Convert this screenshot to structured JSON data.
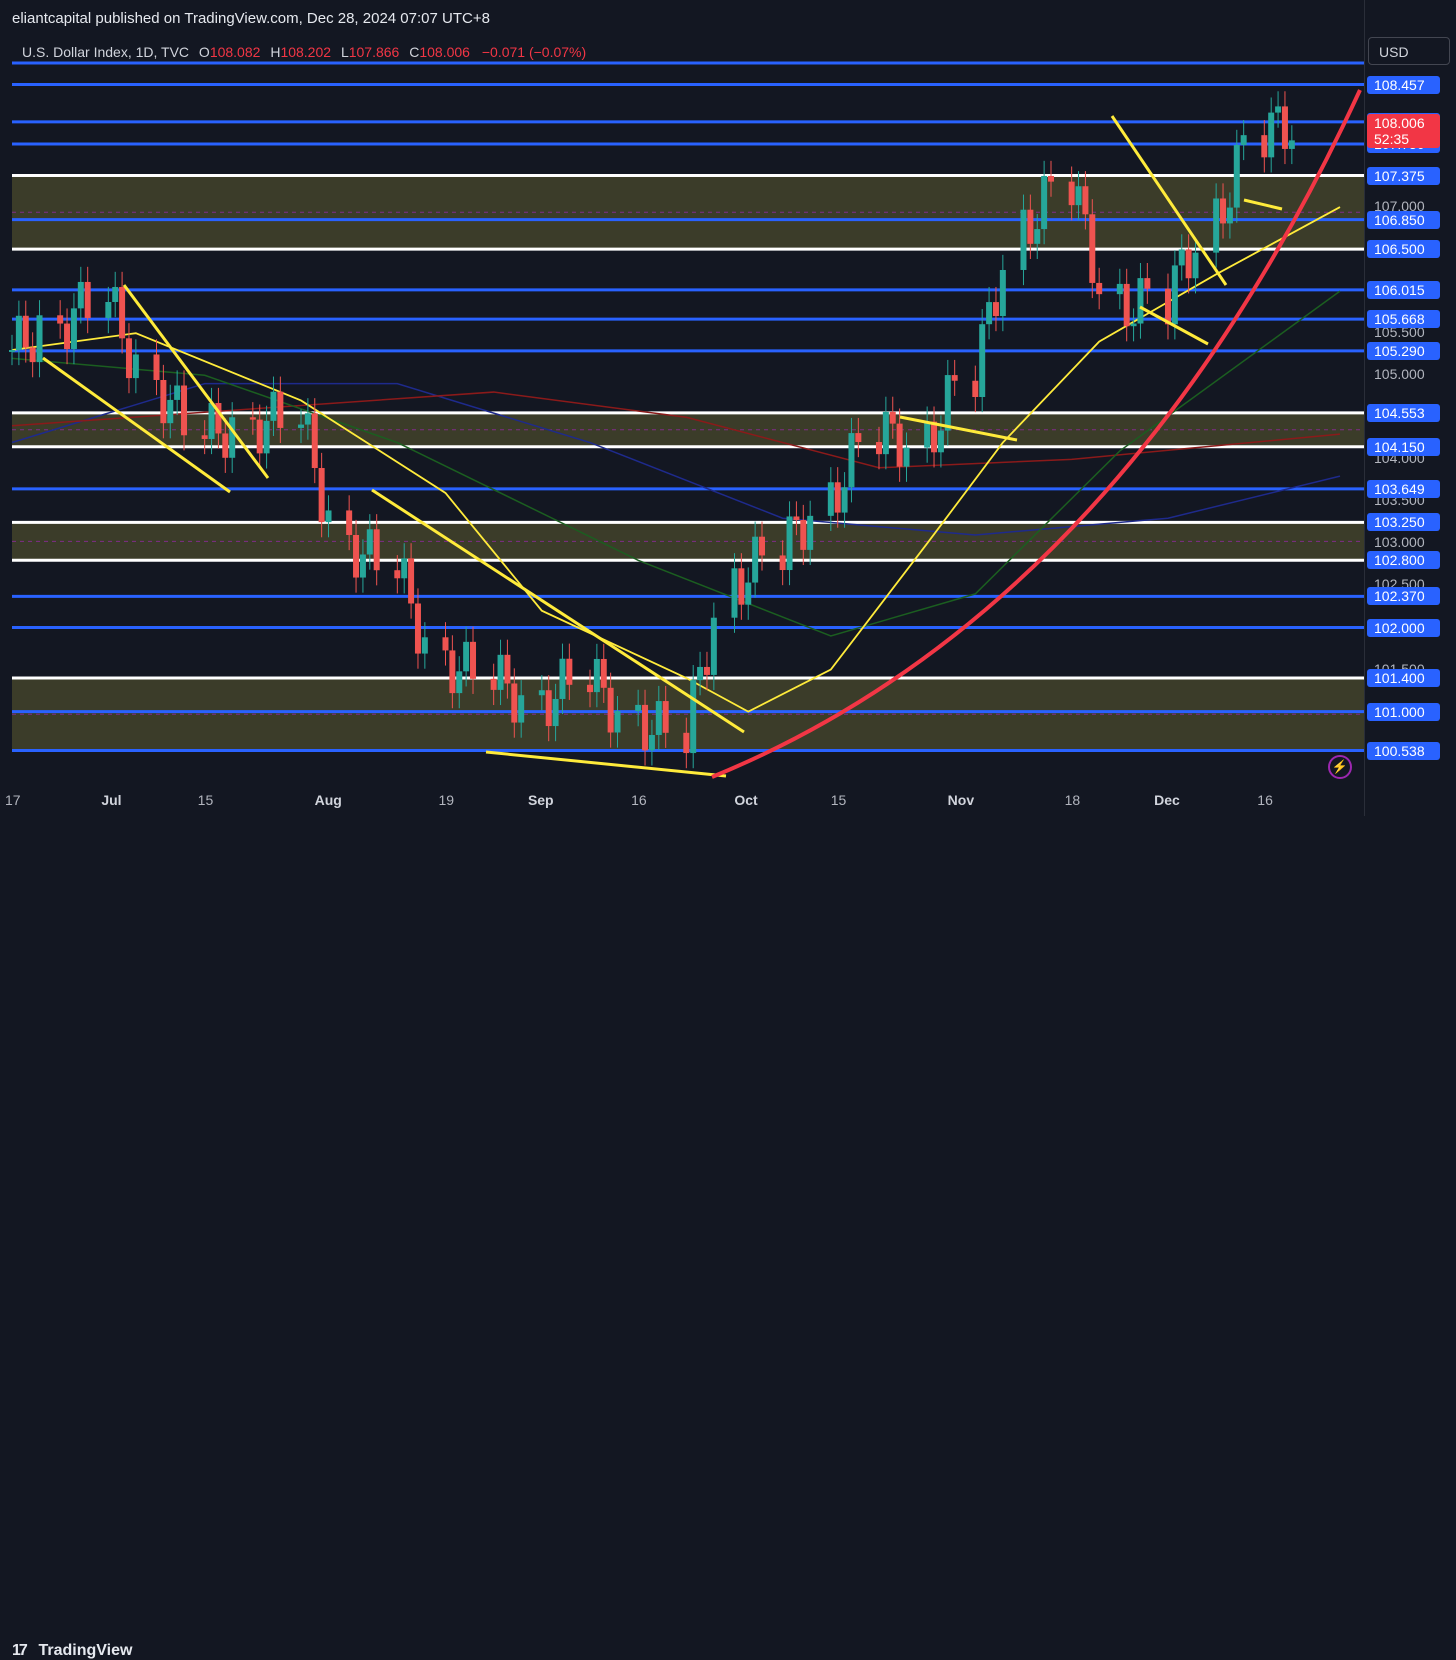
{
  "header": {
    "publisher_text": "eliantcapital published on TradingView.com, Dec 28, 2024 07:07 UTC+8"
  },
  "legend": {
    "symbol": "U.S. Dollar Index, 1D, TVC",
    "open_label": "O",
    "open": "108.082",
    "high_label": "H",
    "high": "108.202",
    "low_label": "L",
    "low": "107.866",
    "close_label": "C",
    "close": "108.006",
    "change": "−0.071 (−0.07%)"
  },
  "price_scale": {
    "currency": "USD",
    "ticks": [
      "107.000",
      "105.500",
      "105.000",
      "104.000",
      "103.500",
      "103.000",
      "102.500",
      "101.500"
    ],
    "level_badges": [
      "108.457",
      "108.013",
      "107.750",
      "107.375",
      "106.850",
      "106.500",
      "106.015",
      "105.668",
      "105.290",
      "104.553",
      "104.150",
      "103.649",
      "103.250",
      "102.800",
      "102.370",
      "102.000",
      "101.400",
      "101.000",
      "100.538"
    ],
    "last_price": "108.006",
    "countdown": "52:35"
  },
  "time_axis": {
    "labels": [
      "17",
      "Jul",
      "15",
      "Aug",
      "19",
      "Sep",
      "16",
      "Oct",
      "15",
      "Nov",
      "18",
      "Dec",
      "16"
    ]
  },
  "footer": {
    "brand": "TradingView",
    "logo_mark": "17"
  },
  "colors": {
    "up": "#26a69a",
    "down": "#ef5350",
    "blue_level": "#2962ff",
    "white_level": "#ffffff",
    "zone": "#4a4a2c",
    "yellow": "#ffeb3b",
    "red_curve": "#f23645"
  },
  "chart_data": {
    "type": "candlestick",
    "symbol": "U.S. Dollar Index, 1D, TVC",
    "ohlc_last": {
      "open": 108.082,
      "high": 108.202,
      "low": 107.866,
      "close": 108.006
    },
    "x_range": [
      "2024-06-17",
      "2024-12-27"
    ],
    "ylim": [
      100.2,
      108.9
    ],
    "horizontal_levels": [
      {
        "price": 108.457,
        "color": "blue"
      },
      {
        "price": 108.013,
        "color": "blue"
      },
      {
        "price": 107.75,
        "color": "blue"
      },
      {
        "price": 107.375,
        "color": "white"
      },
      {
        "price": 106.85,
        "color": "blue"
      },
      {
        "price": 106.5,
        "color": "white"
      },
      {
        "price": 106.015,
        "color": "blue"
      },
      {
        "price": 105.668,
        "color": "blue"
      },
      {
        "price": 105.29,
        "color": "blue"
      },
      {
        "price": 104.553,
        "color": "white"
      },
      {
        "price": 104.15,
        "color": "white"
      },
      {
        "price": 103.649,
        "color": "blue"
      },
      {
        "price": 103.25,
        "color": "white"
      },
      {
        "price": 102.8,
        "color": "white"
      },
      {
        "price": 102.37,
        "color": "blue"
      },
      {
        "price": 102.0,
        "color": "blue"
      },
      {
        "price": 101.4,
        "color": "white"
      },
      {
        "price": 101.0,
        "color": "blue"
      },
      {
        "price": 100.538,
        "color": "blue"
      }
    ],
    "zones": [
      [
        106.5,
        107.375
      ],
      [
        104.15,
        104.553
      ],
      [
        102.8,
        103.25
      ],
      [
        100.538,
        101.4
      ]
    ],
    "close_series": [
      {
        "date": "2024-06-17",
        "close": 105.3
      },
      {
        "date": "2024-06-24",
        "close": 105.6
      },
      {
        "date": "2024-07-01",
        "close": 105.9
      },
      {
        "date": "2024-07-08",
        "close": 104.9
      },
      {
        "date": "2024-07-15",
        "close": 104.3
      },
      {
        "date": "2024-07-22",
        "close": 104.4
      },
      {
        "date": "2024-07-29",
        "close": 104.5
      },
      {
        "date": "2024-08-05",
        "close": 103.0
      },
      {
        "date": "2024-08-12",
        "close": 102.7
      },
      {
        "date": "2024-08-19",
        "close": 101.6
      },
      {
        "date": "2024-08-26",
        "close": 101.4
      },
      {
        "date": "2024-09-02",
        "close": 101.1
      },
      {
        "date": "2024-09-09",
        "close": 101.4
      },
      {
        "date": "2024-09-16",
        "close": 100.9
      },
      {
        "date": "2024-09-23",
        "close": 100.7
      },
      {
        "date": "2024-09-30",
        "close": 102.5
      },
      {
        "date": "2024-10-07",
        "close": 102.9
      },
      {
        "date": "2024-10-14",
        "close": 103.5
      },
      {
        "date": "2024-10-21",
        "close": 104.3
      },
      {
        "date": "2024-10-28",
        "close": 104.2
      },
      {
        "date": "2024-11-04",
        "close": 105.0
      },
      {
        "date": "2024-11-11",
        "close": 106.7
      },
      {
        "date": "2024-11-18",
        "close": 107.3
      },
      {
        "date": "2024-11-25",
        "close": 105.8
      },
      {
        "date": "2024-12-02",
        "close": 105.9
      },
      {
        "date": "2024-12-09",
        "close": 106.8
      },
      {
        "date": "2024-12-16",
        "close": 107.9
      },
      {
        "date": "2024-12-23",
        "close": 108.0
      }
    ]
  }
}
